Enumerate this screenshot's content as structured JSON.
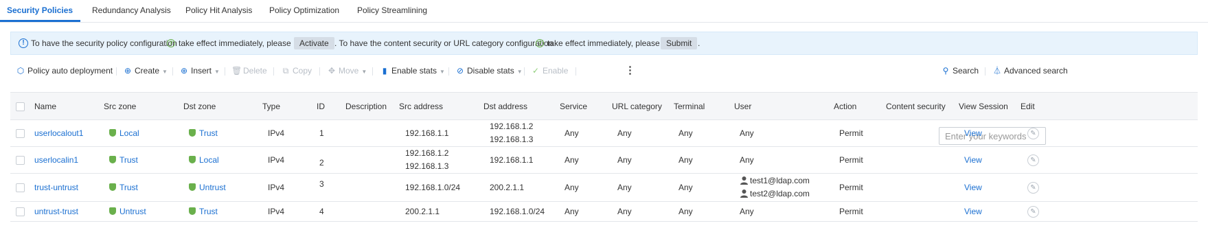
{
  "tabs": [
    {
      "label": "Security Policies",
      "active": true
    },
    {
      "label": "Redundancy Analysis"
    },
    {
      "label": "Policy Hit Analysis"
    },
    {
      "label": "Policy Optimization"
    },
    {
      "label": "Policy Streamlining"
    }
  ],
  "notice": {
    "text1": "To have the security policy configuration",
    "text2": "take effect immediately, please",
    "activate_label": "Activate",
    "text3": ". To have the content security or URL category configuration",
    "text4": "take effect immediately, please",
    "submit_label": "Submit",
    "text5": "."
  },
  "toolbar": {
    "auto_deploy": "Policy auto deployment",
    "create": "Create",
    "insert": "Insert",
    "delete": "Delete",
    "copy": "Copy",
    "move": "Move",
    "enable_stats": "Enable stats",
    "disable_stats": "Disable stats",
    "enable": "Enable",
    "more": "⋮",
    "search_placeholder": "Enter your keywords",
    "search": "Search",
    "advanced_search": "Advanced search"
  },
  "table": {
    "columns": {
      "name": "Name",
      "src_zone": "Src zone",
      "dst_zone": "Dst zone",
      "type": "Type",
      "id": "ID",
      "description": "Description",
      "src_address": "Src address",
      "dst_address": "Dst address",
      "service": "Service",
      "url_category": "URL category",
      "terminal": "Terminal",
      "user": "User",
      "action": "Action",
      "content_security": "Content security",
      "view_session": "View Session",
      "edit": "Edit"
    },
    "rows": [
      {
        "name": "userlocalout1",
        "src_zone": "Local",
        "dst_zone": "Trust",
        "type": "IPv4",
        "id": "1",
        "src_address": [
          "192.168.1.1"
        ],
        "dst_address": [
          "192.168.1.2",
          "192.168.1.3"
        ],
        "service": "Any",
        "url_category": "Any",
        "terminal": "Any",
        "user": [
          "Any"
        ],
        "action": "Permit",
        "view": "View"
      },
      {
        "name": "userlocalin1",
        "src_zone": "Trust",
        "dst_zone": "Local",
        "type": "IPv4",
        "id": "2",
        "src_address": [
          "192.168.1.2",
          "192.168.1.3"
        ],
        "dst_address": [
          "192.168.1.1"
        ],
        "service": "Any",
        "url_category": "Any",
        "terminal": "Any",
        "user": [
          "Any"
        ],
        "action": "Permit",
        "view": "View"
      },
      {
        "name": "trust-untrust",
        "src_zone": "Trust",
        "dst_zone": "Untrust",
        "type": "IPv4",
        "id": "3",
        "src_address": [
          "192.168.1.0/24"
        ],
        "dst_address": [
          "200.2.1.1"
        ],
        "service": "Any",
        "url_category": "Any",
        "terminal": "Any",
        "user": [
          "test1@ldap.com",
          "test2@ldap.com"
        ],
        "action": "Permit",
        "view": "View"
      },
      {
        "name": "untrust-trust",
        "src_zone": "Untrust",
        "dst_zone": "Trust",
        "type": "IPv4",
        "id": "4",
        "src_address": [
          "200.2.1.1"
        ],
        "dst_address": [
          "192.168.1.0/24"
        ],
        "service": "Any",
        "url_category": "Any",
        "terminal": "Any",
        "user": [
          "Any"
        ],
        "action": "Permit",
        "view": "View"
      }
    ]
  },
  "colors": {
    "accent": "#1a6fd1",
    "zone_icon": "#6ab04c",
    "permit": "#3c9a3c",
    "notice_bg": "#e8f3fc"
  }
}
